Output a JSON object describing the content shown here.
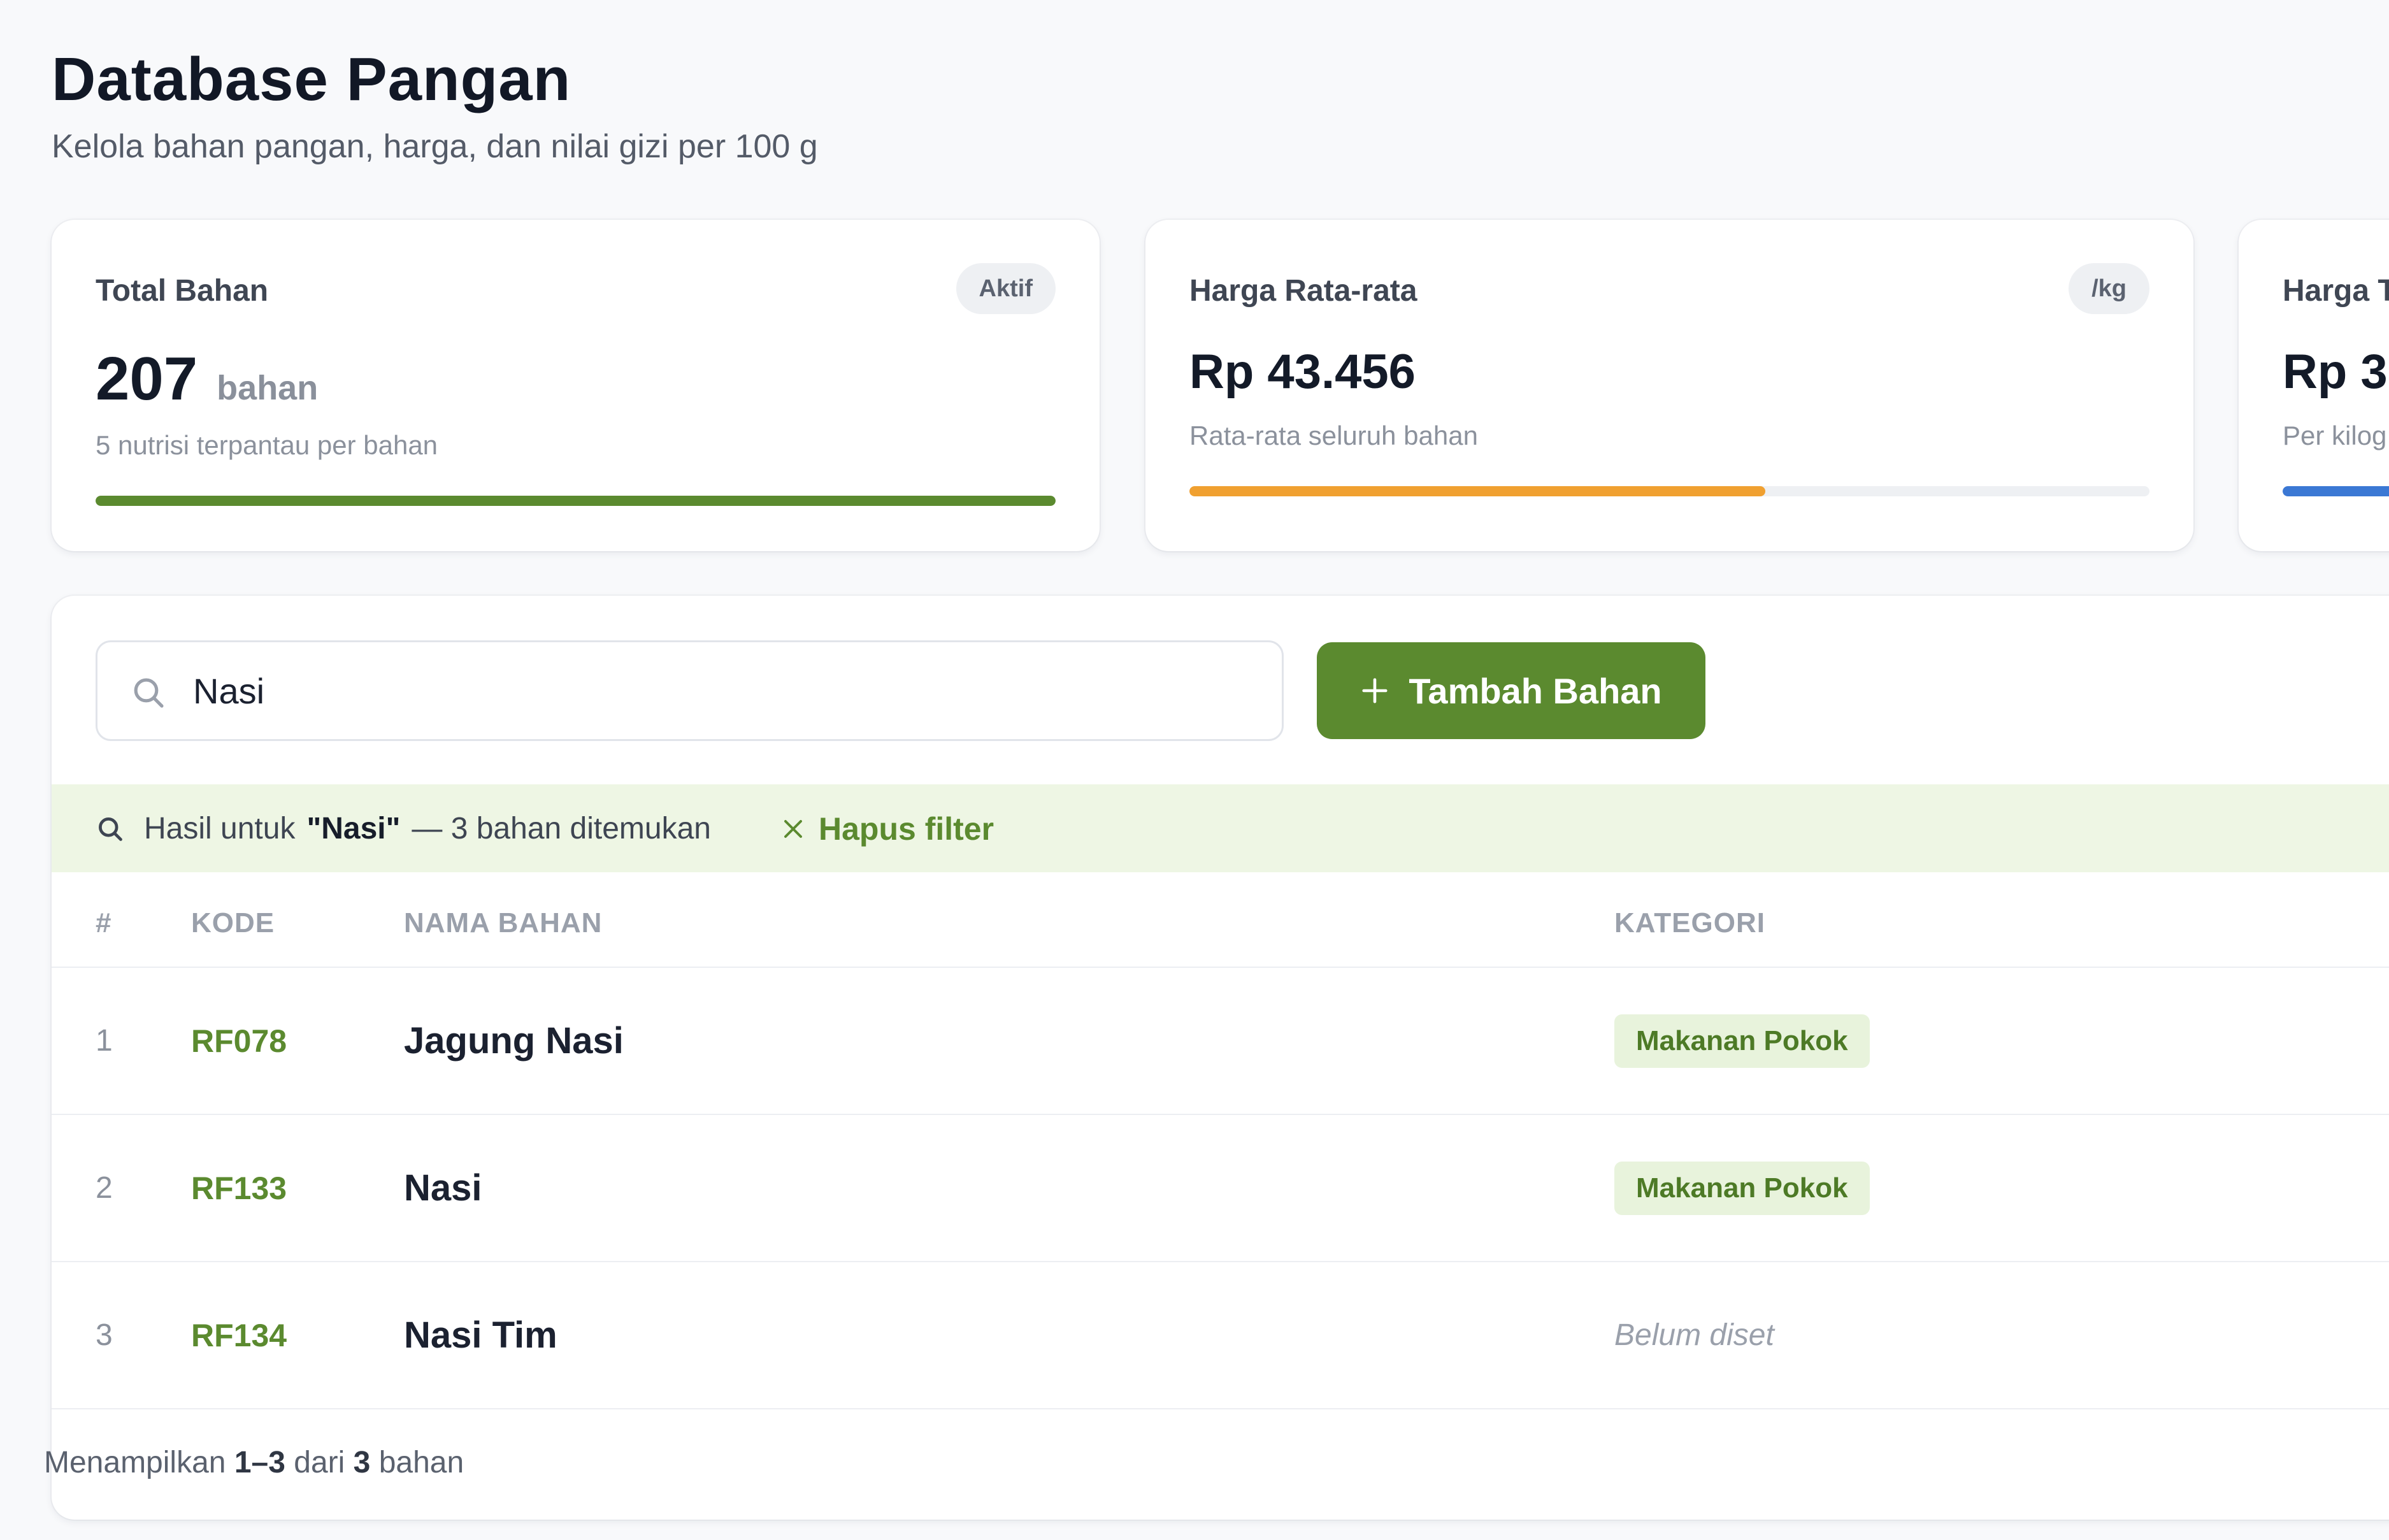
{
  "page": {
    "title": "Database Pangan",
    "subtitle": "Kelola bahan pangan, harga, dan nilai gizi per 100 g"
  },
  "stats": [
    {
      "label": "Total Bahan",
      "badge": "Aktif",
      "value": "207",
      "unit": "bahan",
      "note": "5 nutrisi terpantau per bahan",
      "progress": 1.0,
      "color": "#5b8a2f"
    },
    {
      "label": "Harga Rata-rata",
      "badge": "/kg",
      "value": "Rp 43.456",
      "note": "Rata-rata seluruh bahan",
      "progress": 0.6,
      "color": "#f0a030"
    },
    {
      "label": "Harga T",
      "value": "Rp 3.",
      "note": "Per kilog",
      "color": "#3b78d4"
    }
  ],
  "search": {
    "value": "Nasi"
  },
  "toolbar": {
    "add_label": "Tambah Bahan"
  },
  "filter": {
    "prefix": "Hasil untuk",
    "query": "\"Nasi\"",
    "suffix": "— 3 bahan ditemukan",
    "clear_label": "Hapus filter"
  },
  "table": {
    "columns": [
      "#",
      "KODE",
      "NAMA BAHAN",
      "KATEGORI"
    ],
    "rows": [
      {
        "no": "1",
        "code": "RF078",
        "name": "Jagung Nasi",
        "category": "Makanan Pokok"
      },
      {
        "no": "2",
        "code": "RF133",
        "name": "Nasi",
        "category": "Makanan Pokok"
      },
      {
        "no": "3",
        "code": "RF134",
        "name": "Nasi Tim",
        "category": "",
        "category_empty": "Belum diset"
      }
    ]
  },
  "footer": {
    "prefix": "Menampilkan",
    "range": "1–3",
    "middle": "dari",
    "total": "3",
    "suffix": "bahan"
  },
  "icons": {
    "search": "search-icon",
    "plus": "plus-icon",
    "close": "close-icon"
  }
}
